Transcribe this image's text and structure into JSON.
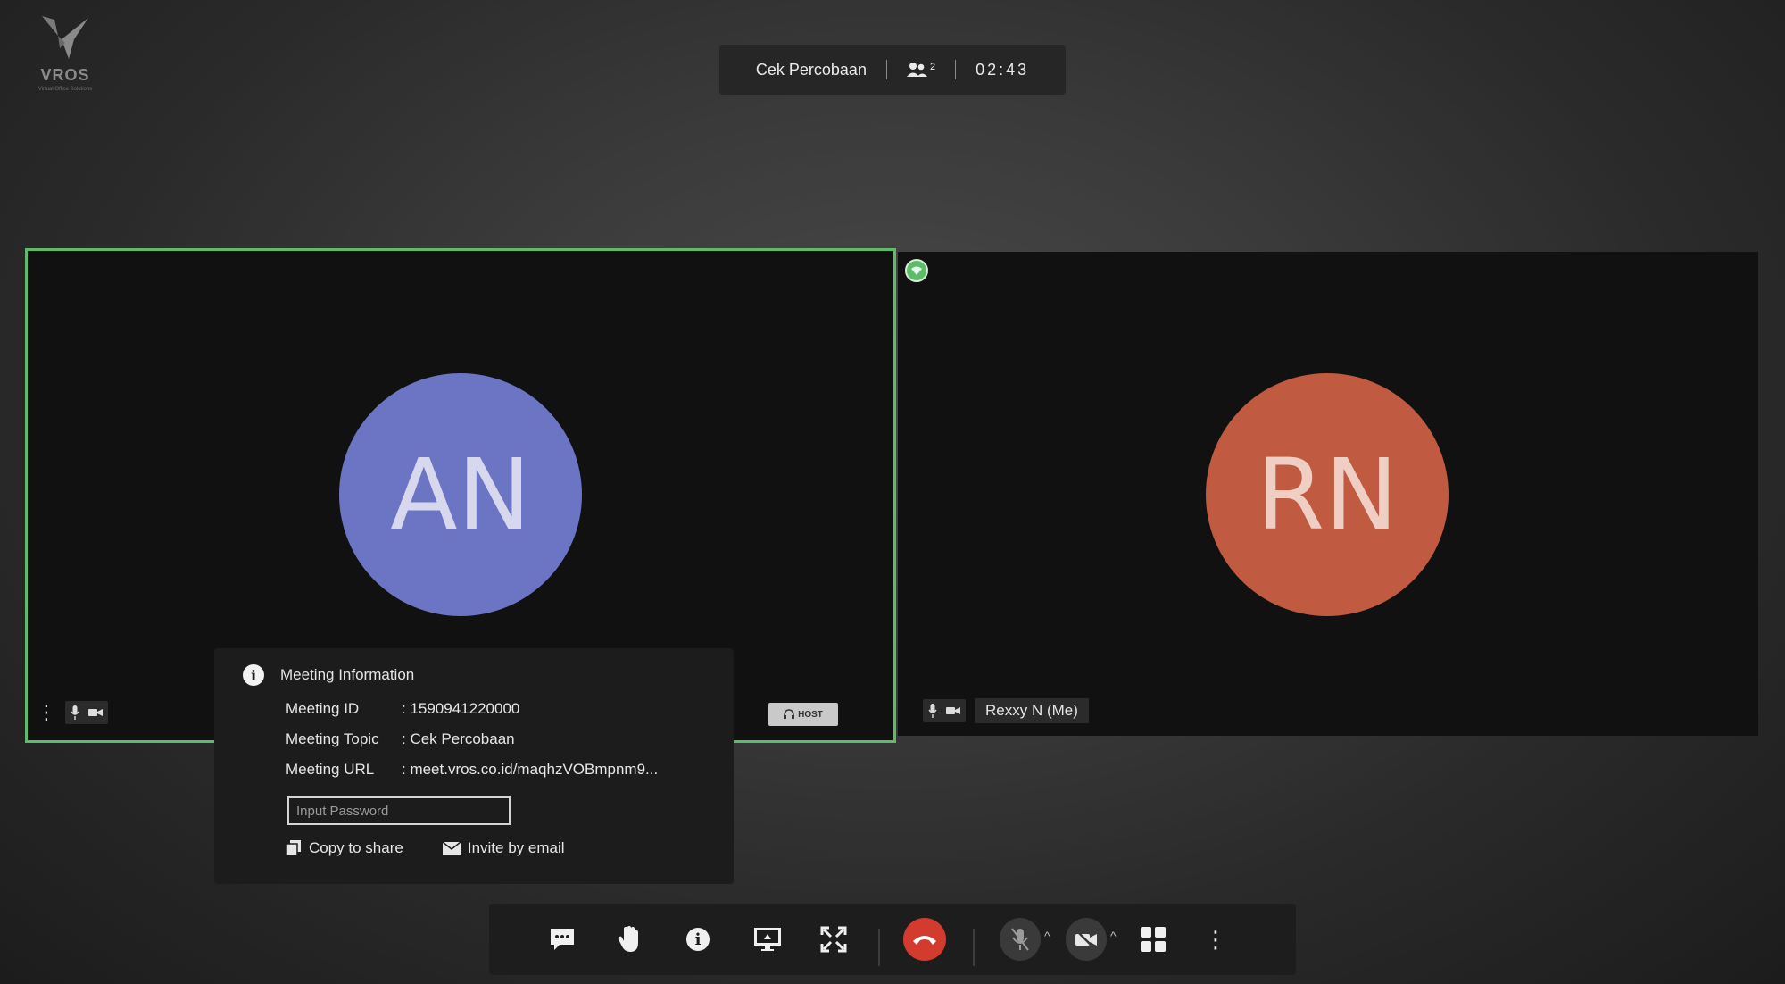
{
  "app": {
    "logo_text": "VROS",
    "logo_subtitle": "Virtual Office Solutions"
  },
  "topbar": {
    "meeting_title": "Cek Percobaan",
    "participant_count": "2",
    "timer": "02:43"
  },
  "tiles": [
    {
      "initials": "AN",
      "avatar_color": "#6c74c4",
      "active_speaker": true,
      "badge": "HOST"
    },
    {
      "initials": "RN",
      "avatar_color": "#c05a40",
      "name": "Rexxy N (Me)"
    }
  ],
  "meeting_info": {
    "title": "Meeting Information",
    "rows": [
      {
        "label": "Meeting ID",
        "value": ": 1590941220000"
      },
      {
        "label": "Meeting Topic",
        "value": ": Cek Percobaan"
      },
      {
        "label": "Meeting URL",
        "value": ": meet.vros.co.id/maqhzVOBmpnm9..."
      }
    ],
    "password_placeholder": "Input Password",
    "copy_label": "Copy to share",
    "invite_label": "Invite by email"
  },
  "colors": {
    "active_border": "#5dbb6a",
    "end_call": "#d23b2e"
  },
  "toolbar_icons": [
    "chat-icon",
    "raise-hand-icon",
    "info-icon",
    "screen-share-icon",
    "fullscreen-icon",
    "end-call-icon",
    "mic-off-icon",
    "camera-off-icon",
    "grid-view-icon",
    "more-icon"
  ]
}
